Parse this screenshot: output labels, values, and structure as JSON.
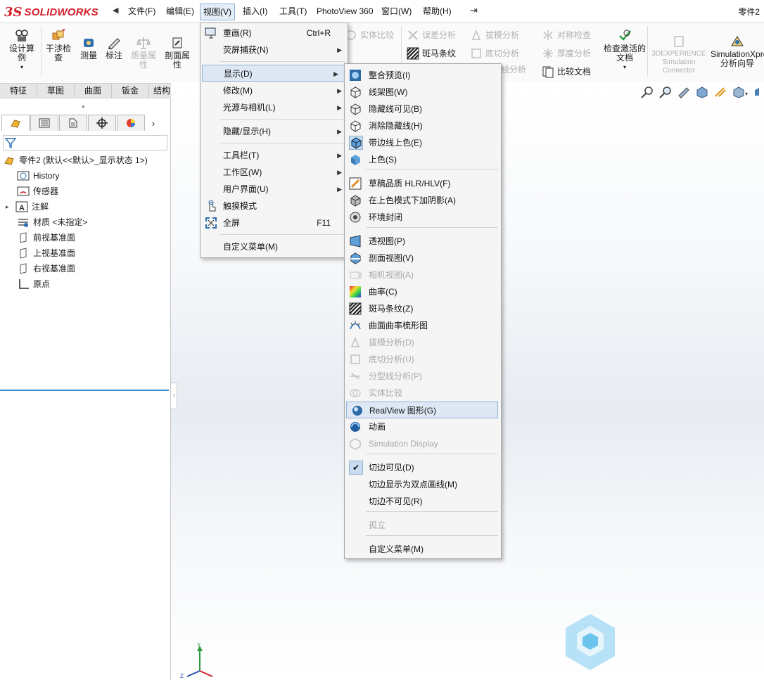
{
  "app": {
    "logo_ds": "3S",
    "logo_text": "SOLIDWORKS",
    "document": "零件2"
  },
  "menubar": {
    "items": [
      "文件(F)",
      "编辑(E)",
      "视图(V)",
      "插入(I)",
      "工具(T)",
      "PhotoView 360",
      "窗口(W)",
      "帮助(H)"
    ],
    "active": "视图(V)"
  },
  "toolbar": {
    "design_study": "设计算例",
    "interference": "干涉检查",
    "measure": "测量",
    "markup": "标注",
    "mass_props": "质量属性",
    "section_props": "剖面属性",
    "solid_compare": "实体比较",
    "deviation": "误差分析",
    "zebra": "斑马条纹",
    "draft_analysis": "拔模分析",
    "undercut": "底切分析",
    "parting_line": "线分析",
    "symmetry": "对称检查",
    "thickness": "厚度分析",
    "compare_docs": "比较文档",
    "check_active": "检查激活的文档",
    "exp_sim": "3DEXPERIENCE Simulation Connector",
    "simxpress": "SimulationXpress分析向导"
  },
  "tabs": [
    "特征",
    "草图",
    "曲面",
    "钣金",
    "结构系统"
  ],
  "tree": {
    "root": "零件2 (默认<<默认>_显示状态 1>)",
    "items": [
      "History",
      "传感器",
      "注解",
      "材质 <未指定>",
      "前视基准面",
      "上视基准面",
      "右视基准面",
      "原点"
    ]
  },
  "view_menu": {
    "items": [
      {
        "label": "重画(R)",
        "shortcut": "Ctrl+R",
        "icon": "redraw-icon"
      },
      {
        "label": "荧屏捕获(N)",
        "submenu": true
      },
      {
        "label": "显示(D)",
        "submenu": true
      },
      {
        "label": "修改(M)",
        "submenu": true
      },
      {
        "label": "光源与相机(L)",
        "submenu": true
      },
      {
        "label": "隐藏/显示(H)",
        "submenu": true
      },
      {
        "label": "工具栏(T)",
        "submenu": true
      },
      {
        "label": "工作区(W)",
        "submenu": true
      },
      {
        "label": "用户界面(U)",
        "submenu": true
      },
      {
        "label": "触摸模式",
        "icon": "touch-icon"
      },
      {
        "label": "全屏",
        "shortcut": "F11",
        "icon": "fullscreen-icon"
      },
      {
        "label": "自定义菜单(M)"
      }
    ]
  },
  "display_menu": {
    "items": [
      {
        "label": "整合预览(I)",
        "icon": "preview-icon"
      },
      {
        "label": "线架图(W)",
        "icon": "wireframe-icon"
      },
      {
        "label": "隐藏线可见(B)",
        "icon": "hidden-lines-visible-icon"
      },
      {
        "label": "消除隐藏线(H)",
        "icon": "hidden-lines-removed-icon"
      },
      {
        "label": "带边线上色(E)",
        "icon": "shaded-edges-icon",
        "checked": true
      },
      {
        "label": "上色(S)",
        "icon": "shaded-icon"
      },
      {
        "label": "草稿品质 HLR/HLV(F)",
        "icon": "draft-quality-icon"
      },
      {
        "label": "在上色模式下加阴影(A)",
        "icon": "shadows-icon"
      },
      {
        "label": "环境封闭",
        "icon": "ambient-occlusion-icon"
      },
      {
        "label": "透视图(P)",
        "icon": "perspective-icon"
      },
      {
        "label": "剖面视图(V)",
        "icon": "section-view-icon"
      },
      {
        "label": "相机视图(A)",
        "icon": "camera-view-icon",
        "disabled": true
      },
      {
        "label": "曲率(C)",
        "icon": "curvature-icon"
      },
      {
        "label": "斑马条纹(Z)",
        "icon": "zebra-icon"
      },
      {
        "label": "曲面曲率梳形图",
        "icon": "curvature-comb-icon"
      },
      {
        "label": "拔模分析(D)",
        "icon": "draft-analysis-icon",
        "disabled": true
      },
      {
        "label": "底切分析(U)",
        "icon": "undercut-icon",
        "disabled": true
      },
      {
        "label": "分型线分析(P)",
        "icon": "parting-line-icon",
        "disabled": true
      },
      {
        "label": "实体比较",
        "icon": "compare-icon",
        "disabled": true
      },
      {
        "label": "RealView 图形(G)",
        "icon": "realview-icon",
        "hover": true
      },
      {
        "label": "动画",
        "icon": "animation-icon"
      },
      {
        "label": "Simulation Display",
        "icon": "simulation-display-icon",
        "disabled": true
      },
      {
        "label": "切边可见(D)",
        "checked": true
      },
      {
        "label": "切边显示为双点画线(M)"
      },
      {
        "label": "切边不可见(R)"
      },
      {
        "label": "孤立",
        "disabled": true
      },
      {
        "label": "自定义菜单(M)"
      }
    ]
  },
  "colors": {
    "accent": "#3e89c6",
    "brand": "#d21f2b",
    "hover": "#dde8f4"
  }
}
